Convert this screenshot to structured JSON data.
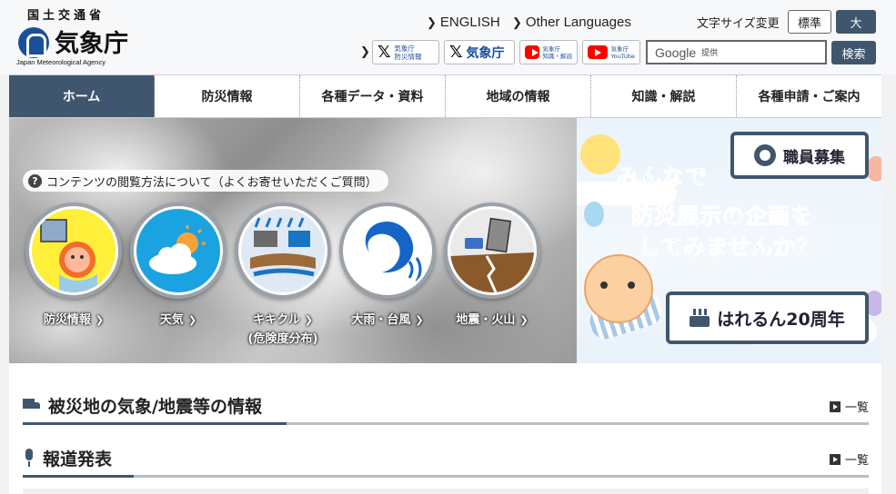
{
  "header": {
    "agency_top": "国土交通省",
    "agency_name": "気象庁",
    "agency_en": "Japan Meteorological Agency",
    "lang_english": "ENGLISH",
    "lang_other": "Other Languages",
    "font_size_label": "文字サイズ変更",
    "font_standard": "標準",
    "font_large": "大",
    "sns": [
      {
        "line1": "気象庁",
        "line2": "防災情報"
      },
      {
        "label": "気象庁"
      },
      {
        "line1": "気象庁",
        "line2": "知識・解説"
      },
      {
        "line1": "気象庁",
        "line2": "YouTube"
      }
    ],
    "search_brand": "Google",
    "search_provided": "提供",
    "search_button": "検索"
  },
  "nav": {
    "items": [
      {
        "label": "ホーム"
      },
      {
        "label": "防災情報"
      },
      {
        "label": "各種データ・資料"
      },
      {
        "label": "地域の情報"
      },
      {
        "label": "知識・解説"
      },
      {
        "label": "各種申請・ご案内"
      }
    ]
  },
  "hero": {
    "faq_text": "コンテンツの閲覧方法について（よくお寄せいただくご質問）",
    "links": [
      {
        "label": "防災情報",
        "sub": ""
      },
      {
        "label": "天気",
        "sub": ""
      },
      {
        "label": "キキクル",
        "sub": "(危険度分布)"
      },
      {
        "label": "大雨・台風",
        "sub": ""
      },
      {
        "label": "地震・火山",
        "sub": ""
      }
    ]
  },
  "banner": {
    "line1": "みんなで",
    "line2": "防災展示の企画を",
    "line3": "してみませんか？",
    "recruit_label": "職員募集",
    "anniversary_label": "はれるん20周年"
  },
  "sections": [
    {
      "title": "被災地の気象/地震等の情報",
      "list_label": "一覧"
    },
    {
      "title": "報道発表",
      "list_label": "一覧"
    }
  ],
  "colors": {
    "primary": "#40566e",
    "brand_blue": "#1a4f9c",
    "youtube_red": "#ff0000"
  }
}
